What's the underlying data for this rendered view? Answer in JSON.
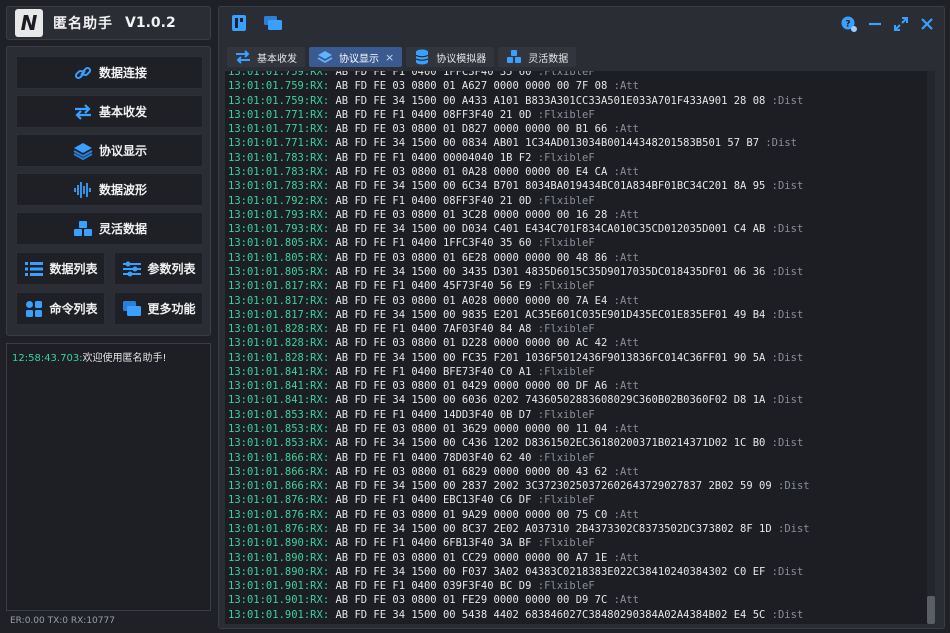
{
  "app": {
    "title": "匿名助手",
    "version": "V1.0.2",
    "logo": "N"
  },
  "menu": {
    "connect": "数据连接",
    "basic_io": "基本收发",
    "protocol_view": "协议显示",
    "waveform": "数据波形",
    "flex_data": "灵活数据",
    "data_list": "数据列表",
    "param_list": "参数列表",
    "cmd_list": "命令列表",
    "more": "更多功能"
  },
  "log": {
    "time": "12:58:43.703:",
    "text": "欢迎使用匿名助手!"
  },
  "status": "ER:0.00 TX:0 RX:10777",
  "tabs": [
    {
      "label": "基本收发"
    },
    {
      "label": "协议显示",
      "close": "×"
    },
    {
      "label": "协议模拟器"
    },
    {
      "label": "灵活数据"
    }
  ],
  "colors": {
    "accent": "#3b5a8f",
    "time": "#39d29a",
    "bg": "#1f2126"
  },
  "rows": [
    [
      "13:01:01.759:RX:",
      " AB FD FE F1 0400 1FFC3F40 35 60",
      " :FlxibleF"
    ],
    [
      "13:01:01.759:RX:",
      " AB FD FE 03 0800 01 A627 0000 0000 00 7F 08",
      " :Att"
    ],
    [
      "13:01:01.759:RX:",
      " AB FD FE 34 1500 00 A433 A101 B833A301CC33A501E033A701F433A901 28 08",
      " :Dist"
    ],
    [
      "13:01:01.771:RX:",
      " AB FD FE F1 0400 08FF3F40 21 0D",
      " :FlxibleF"
    ],
    [
      "13:01:01.771:RX:",
      " AB FD FE 03 0800 01 D827 0000 0000 00 B1 66",
      " :Att"
    ],
    [
      "13:01:01.771:RX:",
      " AB FD FE 34 1500 00 0834 AB01 1C34AD013034B00144348201583B501 57 B7",
      " :Dist"
    ],
    [
      "13:01:01.783:RX:",
      " AB FD FE F1 0400 00004040 1B F2",
      " :FlxibleF"
    ],
    [
      "13:01:01.783:RX:",
      " AB FD FE 03 0800 01 0A28 0000 0000 00 E4 CA",
      " :Att"
    ],
    [
      "13:01:01.783:RX:",
      " AB FD FE 34 1500 00 6C34 B701 8034BA019434BC01A834BF01BC34C201 8A 95",
      " :Dist"
    ],
    [
      "13:01:01.792:RX:",
      " AB FD FE F1 0400 08FF3F40 21 0D",
      " :FlxibleF"
    ],
    [
      "13:01:01.793:RX:",
      " AB FD FE 03 0800 01 3C28 0000 0000 00 16 28",
      " :Att"
    ],
    [
      "13:01:01.793:RX:",
      " AB FD FE 34 1500 00 D034 C401 E434C701F834CA010C35CD012035D001 C4 AB",
      " :Dist"
    ],
    [
      "13:01:01.805:RX:",
      " AB FD FE F1 0400 1FFC3F40 35 60",
      " :FlxibleF"
    ],
    [
      "13:01:01.805:RX:",
      " AB FD FE 03 0800 01 6E28 0000 0000 00 48 86",
      " :Att"
    ],
    [
      "13:01:01.805:RX:",
      " AB FD FE 34 1500 00 3435 D301 4835D6015C35D9017035DC018435DF01 06 36",
      " :Dist"
    ],
    [
      "13:01:01.817:RX:",
      " AB FD FE F1 0400 45F73F40 56 E9",
      " :FlxibleF"
    ],
    [
      "13:01:01.817:RX:",
      " AB FD FE 03 0800 01 A028 0000 0000 00 7A E4",
      " :Att"
    ],
    [
      "13:01:01.817:RX:",
      " AB FD FE 34 1500 00 9835 E201 AC35E601C035E901D435EC01E835EF01 49 B4",
      " :Dist"
    ],
    [
      "13:01:01.828:RX:",
      " AB FD FE F1 0400 7AF03F40 84 A8",
      " :FlxibleF"
    ],
    [
      "13:01:01.828:RX:",
      " AB FD FE 03 0800 01 D228 0000 0000 00 AC 42",
      " :Att"
    ],
    [
      "13:01:01.828:RX:",
      " AB FD FE 34 1500 00 FC35 F201 1036F5012436F9013836FC014C36FF01 90 5A",
      " :Dist"
    ],
    [
      "13:01:01.841:RX:",
      " AB FD FE F1 0400 BFE73F40 C0 A1",
      " :FlxibleF"
    ],
    [
      "13:01:01.841:RX:",
      " AB FD FE 03 0800 01 0429 0000 0000 00 DF A6",
      " :Att"
    ],
    [
      "13:01:01.841:RX:",
      " AB FD FE 34 1500 00 6036 0202 74360502883608029C360B02B0360F02 D8 1A",
      " :Dist"
    ],
    [
      "13:01:01.853:RX:",
      " AB FD FE F1 0400 14DD3F40 0B D7",
      " :FlxibleF"
    ],
    [
      "13:01:01.853:RX:",
      " AB FD FE 03 0800 01 3629 0000 0000 00 11 04",
      " :Att"
    ],
    [
      "13:01:01.853:RX:",
      " AB FD FE 34 1500 00 C436 1202 D8361502EC36180200371B0214371D02 1C B0",
      " :Dist"
    ],
    [
      "13:01:01.866:RX:",
      " AB FD FE F1 0400 78D03F40 62 40",
      " :FlxibleF"
    ],
    [
      "13:01:01.866:RX:",
      " AB FD FE 03 0800 01 6829 0000 0000 00 43 62",
      " :Att"
    ],
    [
      "13:01:01.866:RX:",
      " AB FD FE 34 1500 00 2837 2002 3C37230250372602643729027837 2B02 59 09",
      " :Dist"
    ],
    [
      "13:01:01.876:RX:",
      " AB FD FE F1 0400 EBC13F40 C6 DF",
      " :FlxibleF"
    ],
    [
      "13:01:01.876:RX:",
      " AB FD FE 03 0800 01 9A29 0000 0000 00 75 C0",
      " :Att"
    ],
    [
      "13:01:01.876:RX:",
      " AB FD FE 34 1500 00 8C37 2E02 A037310 2B4373302C8373502DC373802 8F 1D",
      " :Dist"
    ],
    [
      "13:01:01.890:RX:",
      " AB FD FE F1 0400 6FB13F40 3A BF",
      " :FlxibleF"
    ],
    [
      "13:01:01.890:RX:",
      " AB FD FE 03 0800 01 CC29 0000 0000 00 A7 1E",
      " :Att"
    ],
    [
      "13:01:01.890:RX:",
      " AB FD FE 34 1500 00 F037 3A02 04383C0218383E022C38410240384302 C0 EF",
      " :Dist"
    ],
    [
      "13:01:01.901:RX:",
      " AB FD FE F1 0400 039F3F40 BC D9",
      " :FlxibleF"
    ],
    [
      "13:01:01.901:RX:",
      " AB FD FE 03 0800 01 FE29 0000 0000 00 D9 7C",
      " :Att"
    ],
    [
      "13:01:01.901:RX:",
      " AB FD FE 34 1500 00 5438 4402 683846027C38480290384A02A4384B02 E4 5C",
      " :Dist"
    ]
  ]
}
